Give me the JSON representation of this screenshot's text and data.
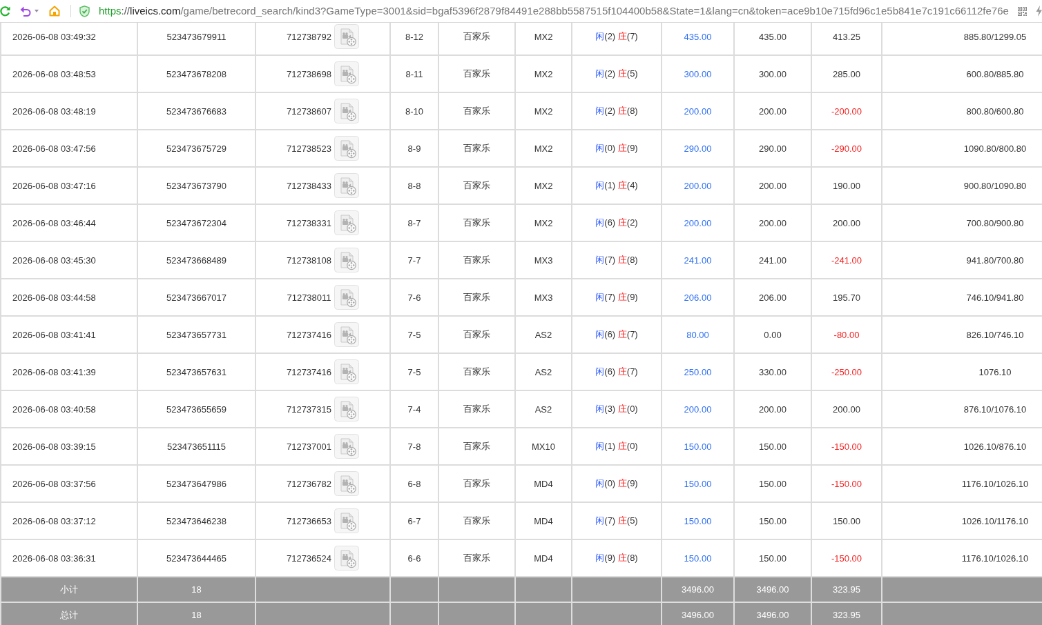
{
  "browser": {
    "address": [
      {
        "kind": "scheme",
        "text": "https"
      },
      {
        "kind": "separator",
        "text": "://"
      },
      {
        "kind": "host",
        "text": "liveics.com"
      },
      {
        "kind": "path",
        "text": "/game/betrecord_search/kind3?GameType=3001&sid=bgaf5396f2879f84491e288bb5587515f104400b58&State=1&lang=cn&token=ace9b10e715fd96c1e5b841e7c191c66112fe76e"
      }
    ]
  },
  "table": {
    "rows": [
      {
        "column_1": "2026-06-08 03:49:32",
        "column_2": "523473679911",
        "column_3": "712738792",
        "column_4": "8-12",
        "column_5": "百家乐",
        "column_6": "MX2",
        "column_7": [
          {
            "kind": "player",
            "label": "闲",
            "points": "(2)"
          },
          {
            "kind": "banker",
            "label": "庄",
            "points": "(7)"
          }
        ],
        "column_8": "435.00",
        "column_9": "435.00",
        "column_10": {
          "text": "413.25",
          "negative": false
        },
        "column_11": "885.80/1299.05"
      },
      {
        "column_1": "2026-06-08 03:48:53",
        "column_2": "523473678208",
        "column_3": "712738698",
        "column_4": "8-11",
        "column_5": "百家乐",
        "column_6": "MX2",
        "column_7": [
          {
            "kind": "player",
            "label": "闲",
            "points": "(2)"
          },
          {
            "kind": "banker",
            "label": "庄",
            "points": "(5)"
          }
        ],
        "column_8": "300.00",
        "column_9": "300.00",
        "column_10": {
          "text": "285.00",
          "negative": false
        },
        "column_11": "600.80/885.80"
      },
      {
        "column_1": "2026-06-08 03:48:19",
        "column_2": "523473676683",
        "column_3": "712738607",
        "column_4": "8-10",
        "column_5": "百家乐",
        "column_6": "MX2",
        "column_7": [
          {
            "kind": "player",
            "label": "闲",
            "points": "(2)"
          },
          {
            "kind": "banker",
            "label": "庄",
            "points": "(8)"
          }
        ],
        "column_8": "200.00",
        "column_9": "200.00",
        "column_10": {
          "text": "-200.00",
          "negative": true
        },
        "column_11": "800.80/600.80"
      },
      {
        "column_1": "2026-06-08 03:47:56",
        "column_2": "523473675729",
        "column_3": "712738523",
        "column_4": "8-9",
        "column_5": "百家乐",
        "column_6": "MX2",
        "column_7": [
          {
            "kind": "player",
            "label": "闲",
            "points": "(0)"
          },
          {
            "kind": "banker",
            "label": "庄",
            "points": "(9)"
          }
        ],
        "column_8": "290.00",
        "column_9": "290.00",
        "column_10": {
          "text": "-290.00",
          "negative": true
        },
        "column_11": "1090.80/800.80"
      },
      {
        "column_1": "2026-06-08 03:47:16",
        "column_2": "523473673790",
        "column_3": "712738433",
        "column_4": "8-8",
        "column_5": "百家乐",
        "column_6": "MX2",
        "column_7": [
          {
            "kind": "player",
            "label": "闲",
            "points": "(1)"
          },
          {
            "kind": "banker",
            "label": "庄",
            "points": "(4)"
          }
        ],
        "column_8": "200.00",
        "column_9": "200.00",
        "column_10": {
          "text": "190.00",
          "negative": false
        },
        "column_11": "900.80/1090.80"
      },
      {
        "column_1": "2026-06-08 03:46:44",
        "column_2": "523473672304",
        "column_3": "712738331",
        "column_4": "8-7",
        "column_5": "百家乐",
        "column_6": "MX2",
        "column_7": [
          {
            "kind": "player",
            "label": "闲",
            "points": "(6)"
          },
          {
            "kind": "banker",
            "label": "庄",
            "points": "(2)"
          }
        ],
        "column_8": "200.00",
        "column_9": "200.00",
        "column_10": {
          "text": "200.00",
          "negative": false
        },
        "column_11": "700.80/900.80"
      },
      {
        "column_1": "2026-06-08 03:45:30",
        "column_2": "523473668489",
        "column_3": "712738108",
        "column_4": "7-7",
        "column_5": "百家乐",
        "column_6": "MX3",
        "column_7": [
          {
            "kind": "player",
            "label": "闲",
            "points": "(7)"
          },
          {
            "kind": "banker",
            "label": "庄",
            "points": "(8)"
          }
        ],
        "column_8": "241.00",
        "column_9": "241.00",
        "column_10": {
          "text": "-241.00",
          "negative": true
        },
        "column_11": "941.80/700.80"
      },
      {
        "column_1": "2026-06-08 03:44:58",
        "column_2": "523473667017",
        "column_3": "712738011",
        "column_4": "7-6",
        "column_5": "百家乐",
        "column_6": "MX3",
        "column_7": [
          {
            "kind": "player",
            "label": "闲",
            "points": "(7)"
          },
          {
            "kind": "banker",
            "label": "庄",
            "points": "(9)"
          }
        ],
        "column_8": "206.00",
        "column_9": "206.00",
        "column_10": {
          "text": "195.70",
          "negative": false
        },
        "column_11": "746.10/941.80"
      },
      {
        "column_1": "2026-06-08 03:41:41",
        "column_2": "523473657731",
        "column_3": "712737416",
        "column_4": "7-5",
        "column_5": "百家乐",
        "column_6": "AS2",
        "column_7": [
          {
            "kind": "player",
            "label": "闲",
            "points": "(6)"
          },
          {
            "kind": "banker",
            "label": "庄",
            "points": "(7)"
          }
        ],
        "column_8": "80.00",
        "column_9": "0.00",
        "column_10": {
          "text": "-80.00",
          "negative": true
        },
        "column_11": "826.10/746.10"
      },
      {
        "column_1": "2026-06-08 03:41:39",
        "column_2": "523473657631",
        "column_3": "712737416",
        "column_4": "7-5",
        "column_5": "百家乐",
        "column_6": "AS2",
        "column_7": [
          {
            "kind": "player",
            "label": "闲",
            "points": "(6)"
          },
          {
            "kind": "banker",
            "label": "庄",
            "points": "(7)"
          }
        ],
        "column_8": "250.00",
        "column_9": "330.00",
        "column_10": {
          "text": "-250.00",
          "negative": true
        },
        "column_11": "1076.10"
      },
      {
        "column_1": "2026-06-08 03:40:58",
        "column_2": "523473655659",
        "column_3": "712737315",
        "column_4": "7-4",
        "column_5": "百家乐",
        "column_6": "AS2",
        "column_7": [
          {
            "kind": "player",
            "label": "闲",
            "points": "(3)"
          },
          {
            "kind": "banker",
            "label": "庄",
            "points": "(0)"
          }
        ],
        "column_8": "200.00",
        "column_9": "200.00",
        "column_10": {
          "text": "200.00",
          "negative": false
        },
        "column_11": "876.10/1076.10"
      },
      {
        "column_1": "2026-06-08 03:39:15",
        "column_2": "523473651115",
        "column_3": "712737001",
        "column_4": "7-8",
        "column_5": "百家乐",
        "column_6": "MX10",
        "column_7": [
          {
            "kind": "player",
            "label": "闲",
            "points": "(1)"
          },
          {
            "kind": "banker",
            "label": "庄",
            "points": "(0)"
          }
        ],
        "column_8": "150.00",
        "column_9": "150.00",
        "column_10": {
          "text": "-150.00",
          "negative": true
        },
        "column_11": "1026.10/876.10"
      },
      {
        "column_1": "2026-06-08 03:37:56",
        "column_2": "523473647986",
        "column_3": "712736782",
        "column_4": "6-8",
        "column_5": "百家乐",
        "column_6": "MD4",
        "column_7": [
          {
            "kind": "player",
            "label": "闲",
            "points": "(0)"
          },
          {
            "kind": "banker",
            "label": "庄",
            "points": "(9)"
          }
        ],
        "column_8": "150.00",
        "column_9": "150.00",
        "column_10": {
          "text": "-150.00",
          "negative": true
        },
        "column_11": "1176.10/1026.10"
      },
      {
        "column_1": "2026-06-08 03:37:12",
        "column_2": "523473646238",
        "column_3": "712736653",
        "column_4": "6-7",
        "column_5": "百家乐",
        "column_6": "MD4",
        "column_7": [
          {
            "kind": "player",
            "label": "闲",
            "points": "(7)"
          },
          {
            "kind": "banker",
            "label": "庄",
            "points": "(5)"
          }
        ],
        "column_8": "150.00",
        "column_9": "150.00",
        "column_10": {
          "text": "150.00",
          "negative": false
        },
        "column_11": "1026.10/1176.10"
      },
      {
        "column_1": "2026-06-08 03:36:31",
        "column_2": "523473644465",
        "column_3": "712736524",
        "column_4": "6-6",
        "column_5": "百家乐",
        "column_6": "MD4",
        "column_7": [
          {
            "kind": "player",
            "label": "闲",
            "points": "(9)"
          },
          {
            "kind": "banker",
            "label": "庄",
            "points": "(8)"
          }
        ],
        "column_8": "150.00",
        "column_9": "150.00",
        "column_10": {
          "text": "-150.00",
          "negative": true
        },
        "column_11": "1176.10/1026.10"
      }
    ],
    "summary": [
      {
        "column_1": "小计",
        "column_2": "18",
        "column_8": "3496.00",
        "column_9": "3496.00",
        "column_10": "323.95"
      },
      {
        "column_1": "总计",
        "column_2": "18",
        "column_8": "3496.00",
        "column_9": "3496.00",
        "column_10": "323.95"
      }
    ]
  }
}
